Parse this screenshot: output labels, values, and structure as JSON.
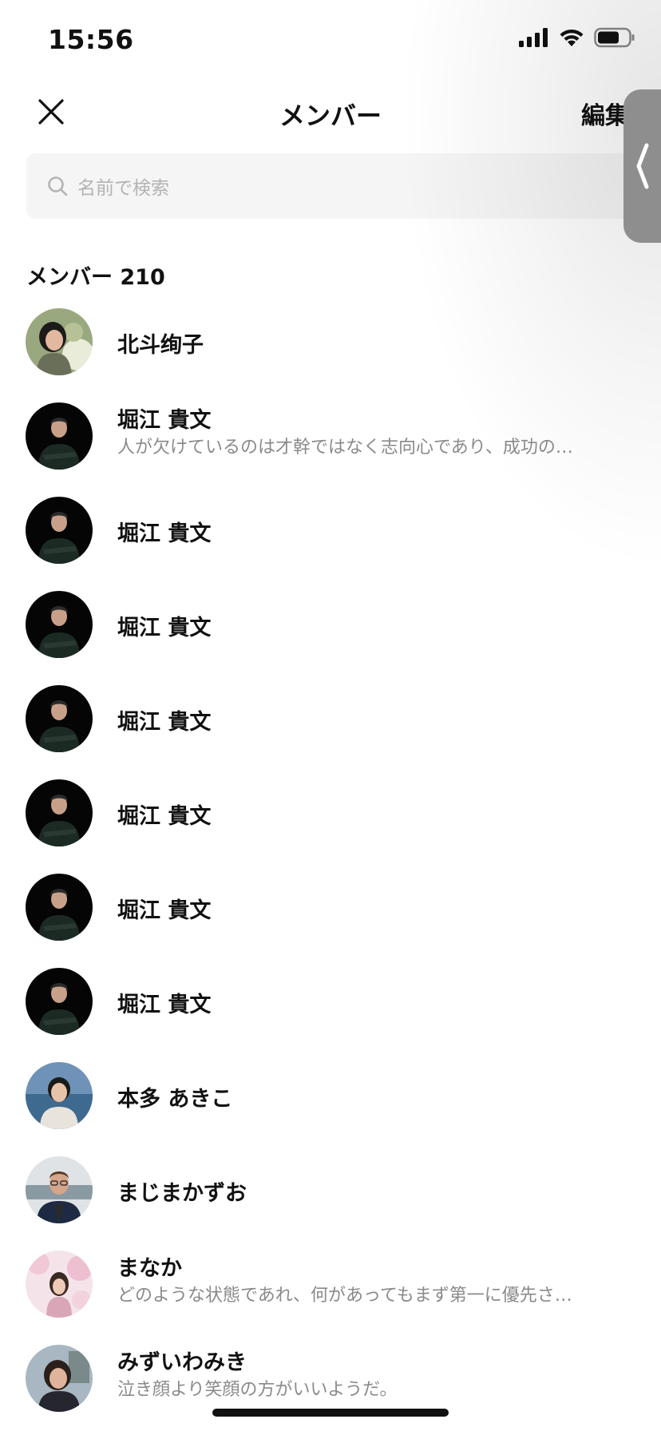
{
  "status_bar": {
    "time": "15:56"
  },
  "nav": {
    "title": "メンバー",
    "edit_label": "編集"
  },
  "search": {
    "placeholder": "名前で検索"
  },
  "section": {
    "header": "メンバー 210"
  },
  "members": [
    {
      "name": "北斗绚子",
      "status": "",
      "avatar": "photo-woman-flowers"
    },
    {
      "name": "堀江 貴文",
      "status": "人が欠けているのは才幹ではなく志向心であり、成功の…",
      "avatar": "photo-man-dark"
    },
    {
      "name": "堀江 貴文",
      "status": "",
      "avatar": "photo-man-dark"
    },
    {
      "name": "堀江 貴文",
      "status": "",
      "avatar": "photo-man-dark"
    },
    {
      "name": "堀江 貴文",
      "status": "",
      "avatar": "photo-man-dark"
    },
    {
      "name": "堀江 貴文",
      "status": "",
      "avatar": "photo-man-dark"
    },
    {
      "name": "堀江 貴文",
      "status": "",
      "avatar": "photo-man-dark"
    },
    {
      "name": "堀江 貴文",
      "status": "",
      "avatar": "photo-man-dark"
    },
    {
      "name": "本多 あきこ",
      "status": "",
      "avatar": "photo-woman-sea"
    },
    {
      "name": "まじまかずお",
      "status": "",
      "avatar": "photo-man-glasses"
    },
    {
      "name": "まなか",
      "status": "どのような状態であれ、何があってもまず第一に優先さ…",
      "avatar": "photo-woman-blossoms"
    },
    {
      "name": "みずいわみき",
      "status": "泣き顔より笑顔の方がいいようだ。",
      "avatar": "photo-woman-outdoor"
    }
  ]
}
